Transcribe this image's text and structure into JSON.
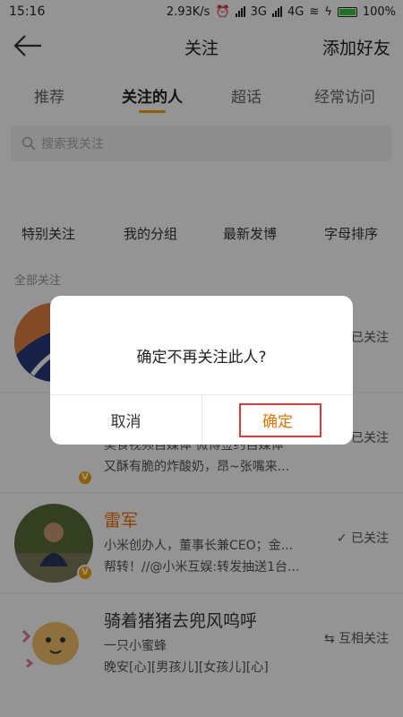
{
  "status_bar": {
    "time": "15:16",
    "speed": "2.93K/s",
    "network1": "3G",
    "network2": "4G",
    "battery": "100%"
  },
  "nav": {
    "title": "关注",
    "right_action": "添加好友"
  },
  "tabs": [
    {
      "label": "推荐"
    },
    {
      "label": "关注的人"
    },
    {
      "label": "超话"
    },
    {
      "label": "经常访问"
    }
  ],
  "search": {
    "placeholder": "搜索我关注"
  },
  "filters": [
    "特别关注",
    "我的分组",
    "最新发博",
    "字母排序"
  ],
  "section_label": "全部关注",
  "users": [
    {
      "name": "",
      "line1": "",
      "line2": "",
      "follow": "已关注"
    },
    {
      "name": "",
      "line1": "美食视频自媒体 微博签约自媒体",
      "line2": "又酥有脆的炸酸奶，昂~张嘴来...",
      "follow": "已关注"
    },
    {
      "name": "雷军",
      "line1": "小米创办人，董事长兼CEO；金...",
      "line2": "帮转！//@小米互娱:转发抽送1台...",
      "follow": "已关注"
    },
    {
      "name": "骑着猪猪去兜风呜呼",
      "line1": "一只小蜜蜂",
      "line2": "晚安[心][男孩儿][女孩儿][心]",
      "follow": "互相关注"
    }
  ],
  "dialog": {
    "message": "确定不再关注此人?",
    "cancel": "取消",
    "confirm": "确定"
  },
  "colors": {
    "accent": "#f7a500",
    "confirm": "#f07000",
    "highlight_box": "#e53935"
  }
}
